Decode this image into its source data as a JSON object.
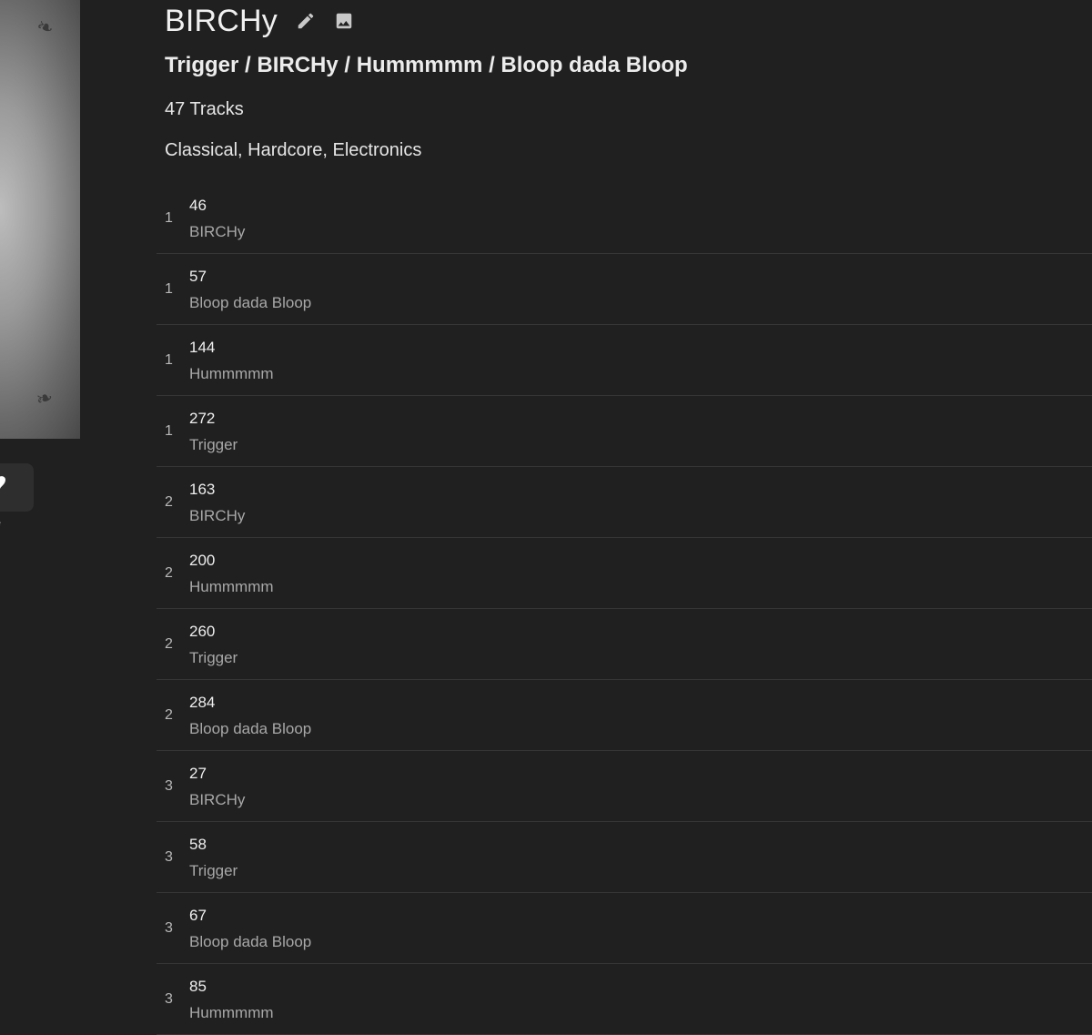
{
  "playlist": {
    "title": "BIRCHy",
    "edit_icon": "pencil-icon",
    "image_icon": "image-icon",
    "subtitle": "Trigger / BIRCHy / Hummmmm / Bloop dada Bloop",
    "track_count": "47 Tracks",
    "genres": "Classical, Hardcore, Electronics"
  },
  "sidebar": {
    "favorite_icon": "heart-icon",
    "favorite_label": "rite"
  },
  "tracks": [
    {
      "number": "1",
      "title": "46",
      "artist": "BIRCHy"
    },
    {
      "number": "1",
      "title": "57",
      "artist": "Bloop dada Bloop"
    },
    {
      "number": "1",
      "title": "144",
      "artist": "Hummmmm"
    },
    {
      "number": "1",
      "title": "272",
      "artist": "Trigger"
    },
    {
      "number": "2",
      "title": "163",
      "artist": "BIRCHy"
    },
    {
      "number": "2",
      "title": "200",
      "artist": "Hummmmm"
    },
    {
      "number": "2",
      "title": "260",
      "artist": "Trigger"
    },
    {
      "number": "2",
      "title": "284",
      "artist": "Bloop dada Bloop"
    },
    {
      "number": "3",
      "title": "27",
      "artist": "BIRCHy"
    },
    {
      "number": "3",
      "title": "58",
      "artist": "Trigger"
    },
    {
      "number": "3",
      "title": "67",
      "artist": "Bloop dada Bloop"
    },
    {
      "number": "3",
      "title": "85",
      "artist": "Hummmmm"
    }
  ],
  "colors": {
    "background": "#202020",
    "divider": "#363636",
    "secondary_text": "#a8a8a8"
  }
}
